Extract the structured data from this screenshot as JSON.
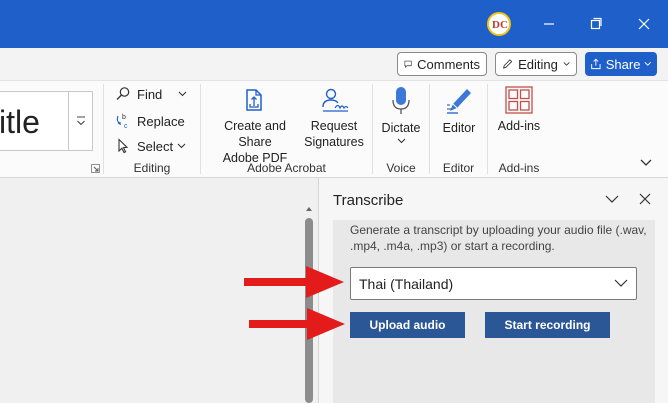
{
  "titlebar": {
    "avatar_initials": "DC"
  },
  "toprow": {
    "comments_label": "Comments",
    "editing_label": "Editing",
    "share_label": "Share"
  },
  "ribbon": {
    "style_preview_text": "itle",
    "editing_group": {
      "find_label": "Find",
      "replace_label": "Replace",
      "select_label": "Select",
      "group_label": "Editing"
    },
    "acrobat_group": {
      "create_share_label_1": "Create and Share",
      "create_share_label_2": "Adobe PDF",
      "request_sign_label_1": "Request",
      "request_sign_label_2": "Signatures",
      "group_label": "Adobe Acrobat"
    },
    "voice_group": {
      "dictate_label": "Dictate",
      "group_label": "Voice"
    },
    "editor_group": {
      "editor_label": "Editor",
      "group_label": "Editor"
    },
    "addins_group": {
      "addins_label": "Add-ins",
      "group_label": "Add-ins"
    }
  },
  "pane": {
    "title": "Transcribe",
    "description": "Generate a transcript by uploading your audio file (.wav, .mp4, .m4a, .mp3) or start a recording.",
    "language_selected": "Thai (Thailand)",
    "upload_label": "Upload audio",
    "record_label": "Start recording"
  },
  "colors": {
    "titlebar": "#1f5fc9",
    "pane_button": "#2b5797",
    "annotation_arrow": "#e31b1b"
  }
}
